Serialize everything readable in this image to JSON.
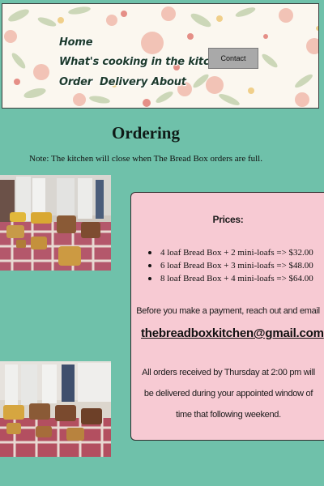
{
  "header": {
    "nav": {
      "home": "Home",
      "whats_cooking": "What's cooking in the kitchen",
      "order": "Order",
      "delivery": "Delivery",
      "about": "About"
    },
    "contact_label": "Contact"
  },
  "main": {
    "title": "Ordering",
    "note": "Note: The kitchen will close when The Bread Box orders are full."
  },
  "prices": {
    "heading": "Prices:",
    "items": [
      "4 loaf Bread Box + 2 mini-loafs => $32.00",
      "6 loaf Bread Box + 3 mini-loafs => $48.00",
      "8 loaf Bread Box + 4 mini-loafs => $64.00"
    ],
    "before_payment": "Before you make a payment, reach out and email",
    "email": "thebreadboxkitchen@gmail.com",
    "orders_info": "All orders received by Thursday at 2:00 pm will be delivered during your appointed window of time that following weekend."
  },
  "colors": {
    "page_background": "#6fc1aa",
    "card_background": "#f7cad3",
    "contact_button": "#a9a9a9"
  }
}
